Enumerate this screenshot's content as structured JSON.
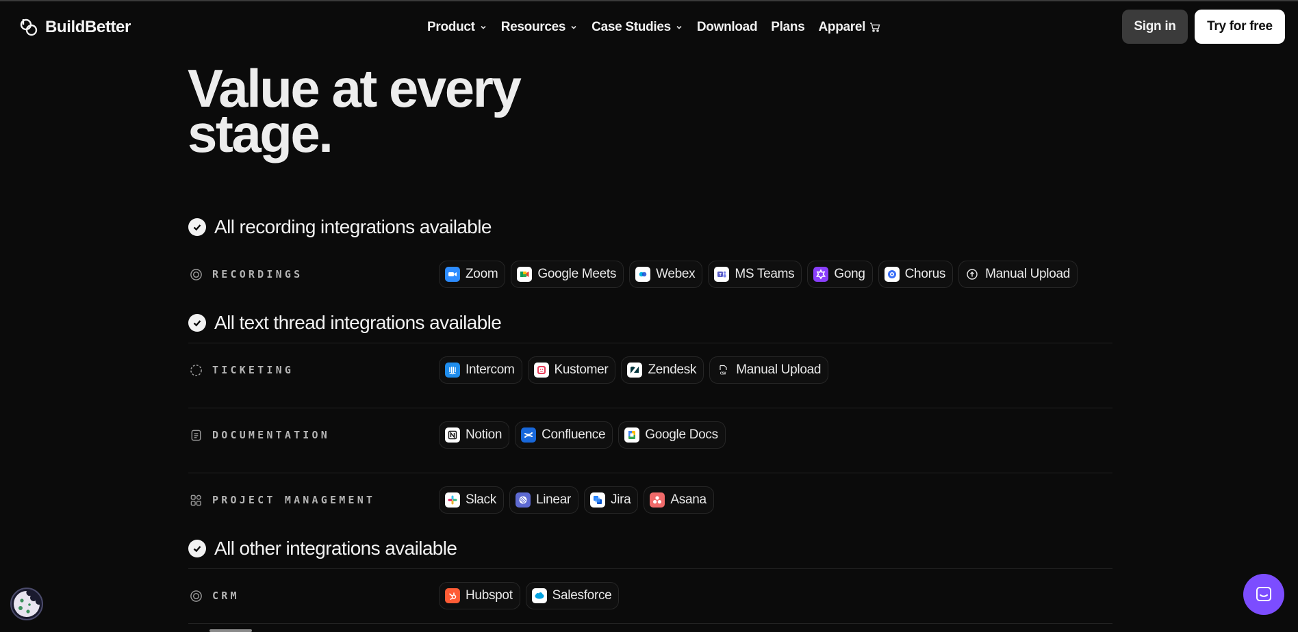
{
  "brand": {
    "name": "BuildBetter"
  },
  "nav": {
    "items": [
      {
        "label": "Product",
        "dropdown": true
      },
      {
        "label": "Resources",
        "dropdown": true
      },
      {
        "label": "Case Studies",
        "dropdown": true
      },
      {
        "label": "Download",
        "dropdown": false
      },
      {
        "label": "Plans",
        "dropdown": false
      },
      {
        "label": "Apparel",
        "dropdown": false,
        "icon": "cart-icon"
      }
    ],
    "sign_in": "Sign in",
    "try_free": "Try for free"
  },
  "hero": {
    "line1": "Value at every",
    "line2": "stage."
  },
  "sections": [
    {
      "title": "All recording integrations available",
      "rows": [
        {
          "label": "RECORDINGS",
          "icon": "target-icon",
          "chips": [
            {
              "label": "Zoom",
              "icon": "zoom-icon",
              "color": "#2d8cff"
            },
            {
              "label": "Google Meets",
              "icon": "google-meet-icon",
              "color": "#ffffff"
            },
            {
              "label": "Webex",
              "icon": "webex-icon",
              "color": "#ffffff"
            },
            {
              "label": "MS Teams",
              "icon": "ms-teams-icon",
              "color": "#ffffff"
            },
            {
              "label": "Gong",
              "icon": "gong-icon",
              "color": "#8a3ffc"
            },
            {
              "label": "Chorus",
              "icon": "chorus-icon",
              "color": "#ffffff"
            },
            {
              "label": "Manual Upload",
              "icon": "upload-icon",
              "color": "transparent"
            }
          ]
        }
      ]
    },
    {
      "title": "All text thread integrations available",
      "rows": [
        {
          "label": "TICKETING",
          "icon": "dashed-circle-icon",
          "chips": [
            {
              "label": "Intercom",
              "icon": "intercom-icon",
              "color": "#1f8ded"
            },
            {
              "label": "Kustomer",
              "icon": "kustomer-icon",
              "color": "#ffffff"
            },
            {
              "label": "Zendesk",
              "icon": "zendesk-icon",
              "color": "#ffffff"
            },
            {
              "label": "Manual Upload",
              "icon": "csv-file-icon",
              "color": "transparent"
            }
          ]
        },
        {
          "label": "DOCUMENTATION",
          "icon": "document-icon",
          "chips": [
            {
              "label": "Notion",
              "icon": "notion-icon",
              "color": "#ffffff"
            },
            {
              "label": "Confluence",
              "icon": "confluence-icon",
              "color": "#1868db"
            },
            {
              "label": "Google Docs",
              "icon": "google-docs-icon",
              "color": "#ffffff"
            }
          ]
        },
        {
          "label": "PROJECT MANAGEMENT",
          "icon": "grid-icon",
          "chips": [
            {
              "label": "Slack",
              "icon": "slack-icon",
              "color": "#ffffff"
            },
            {
              "label": "Linear",
              "icon": "linear-icon",
              "color": "#5e6ad2"
            },
            {
              "label": "Jira",
              "icon": "jira-icon",
              "color": "#ffffff"
            },
            {
              "label": "Asana",
              "icon": "asana-icon",
              "color": "#f06a6a"
            }
          ]
        }
      ]
    },
    {
      "title": "All other integrations available",
      "rows": [
        {
          "label": "CRM",
          "icon": "target-icon",
          "chips": [
            {
              "label": "Hubspot",
              "icon": "hubspot-icon",
              "color": "#ff5c35"
            },
            {
              "label": "Salesforce",
              "icon": "salesforce-icon",
              "color": "#ffffff"
            }
          ]
        }
      ]
    }
  ],
  "widgets": {
    "cookie": "cookie-icon",
    "chat": "chat-icon",
    "chat_color": "#7c4dff"
  }
}
